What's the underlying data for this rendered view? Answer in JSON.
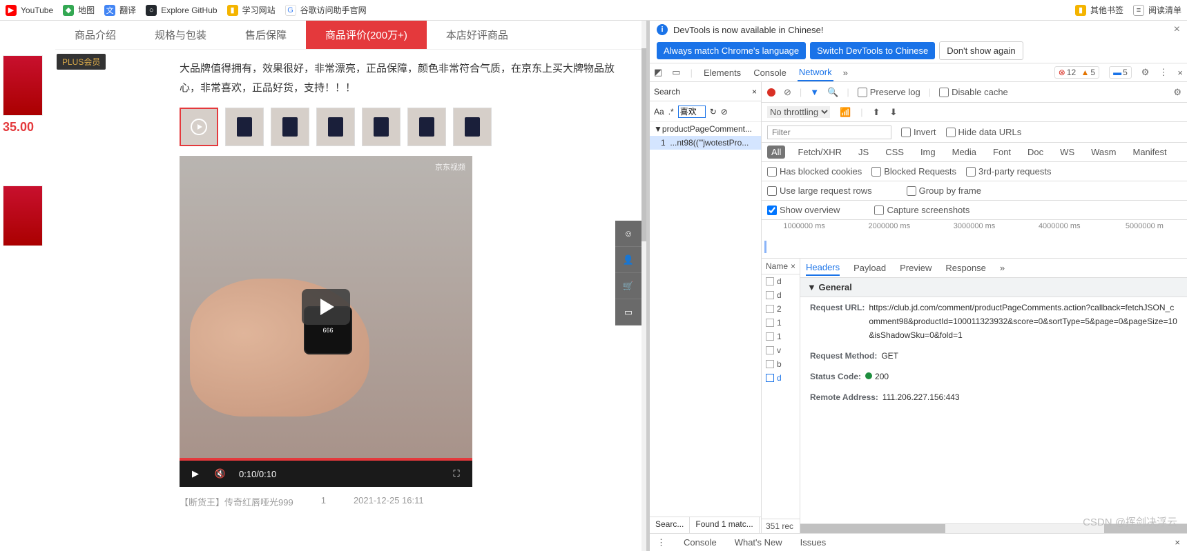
{
  "bookmarks": {
    "items": [
      {
        "label": "YouTube",
        "color": "#ff0000"
      },
      {
        "label": "地图",
        "color": "#34a853"
      },
      {
        "label": "翻译",
        "color": "#4285f4"
      },
      {
        "label": "Explore GitHub",
        "color": "#24292e"
      },
      {
        "label": "学习网站",
        "color": "#f4b400"
      },
      {
        "label": "谷歌访问助手官网",
        "color": "#4285f4"
      }
    ],
    "right": [
      {
        "label": "其他书签",
        "color": "#f4b400"
      },
      {
        "label": "阅读清单",
        "color": "#5f6368"
      }
    ]
  },
  "page": {
    "price": "35.00",
    "plus_badge": "PLUS会员",
    "tabs": [
      "商品介绍",
      "规格与包装",
      "售后保障",
      "商品评价(200万+)",
      "本店好评商品"
    ],
    "active_tab": 3,
    "review_text": "大品牌值得拥有，效果很好，非常漂亮，正品保障，颜色非常符合气质，在京东上买大牌物品放心，非常喜欢，正品好货，支持！！！",
    "video": {
      "logo": "京东视频",
      "time": "0:10/0:10"
    },
    "meta": {
      "sku": "【断货王】传奇红唇哑光999",
      "qty": "1",
      "date": "2021-12-25 16:11"
    }
  },
  "devtools": {
    "info_banner": "DevTools is now available in Chinese!",
    "lang_buttons": {
      "match": "Always match Chrome's language",
      "switch": "Switch DevTools to Chinese",
      "dont": "Don't show again"
    },
    "main_tabs": [
      "Elements",
      "Console",
      "Network"
    ],
    "main_active": 2,
    "counts": {
      "errors": "12",
      "warnings": "5",
      "issues": "5"
    },
    "search": {
      "title": "Search",
      "input_value": "喜欢",
      "regex": ".*",
      "tree_parent": "productPageComment...",
      "tree_child_num": "1",
      "tree_child": "...nt98(('\"jwotestPro...",
      "footer_search": "Searc...",
      "footer_found": "Found 1 matc..."
    },
    "network": {
      "toolbar": {
        "preserve": "Preserve log",
        "disable": "Disable cache"
      },
      "throttle": "No throttling",
      "filter_placeholder": "Filter",
      "filter_opts": {
        "invert": "Invert",
        "hide": "Hide data URLs"
      },
      "types": [
        "All",
        "Fetch/XHR",
        "JS",
        "CSS",
        "Img",
        "Media",
        "Font",
        "Doc",
        "WS",
        "Wasm",
        "Manifest"
      ],
      "type_active": 0,
      "type_opts": {
        "blocked_cookies": "Has blocked cookies",
        "blocked_req": "Blocked Requests",
        "third": "3rd-party requests"
      },
      "view_opts": {
        "large": "Use large request rows",
        "group": "Group by frame",
        "overview": "Show overview",
        "capture": "Capture screenshots"
      },
      "timeline": [
        "1000000 ms",
        "2000000 ms",
        "3000000 ms",
        "4000000 ms",
        "5000000 m"
      ],
      "reqlist": {
        "header": "Name",
        "rows": [
          "d",
          "d",
          "2",
          "1",
          "1",
          "v",
          "b",
          "d"
        ],
        "sel": 7,
        "footer": "351 rec"
      },
      "detail": {
        "tabs": [
          "Headers",
          "Payload",
          "Preview",
          "Response"
        ],
        "active": 0,
        "general_label": "General",
        "request_url_k": "Request URL:",
        "request_url_v": "https://club.jd.com/comment/productPageComments.action?callback=fetchJSON_comment98&productId=100011323932&score=0&sortType=5&page=0&pageSize=10&isShadowSku=0&fold=1",
        "request_method_k": "Request Method:",
        "request_method_v": "GET",
        "status_code_k": "Status Code:",
        "status_code_v": "200",
        "remote_k": "Remote Address:",
        "remote_v": "111.206.227.156:443"
      }
    },
    "drawer": {
      "console": "Console",
      "whatsnew": "What's New",
      "issues": "Issues"
    }
  },
  "watermark": "CSDN @挥剑决浮云"
}
